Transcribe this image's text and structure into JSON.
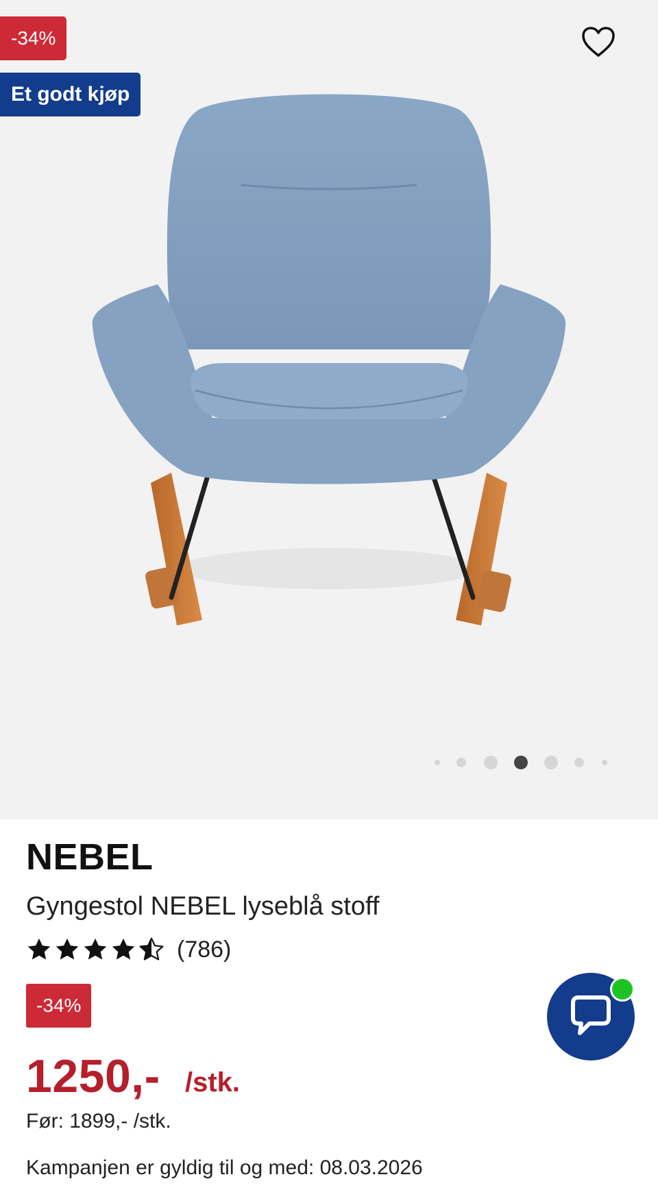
{
  "gallery": {
    "discount_badge": "-34%",
    "good_buy_badge": "Et godt kjøp",
    "favorite_icon": "heart-outline-icon",
    "image_count": 7,
    "active_image_index": 3
  },
  "product": {
    "brand": "NEBEL",
    "name": "Gyngestol NEBEL lyseblå stoff",
    "rating": 4.5,
    "rating_max": 5,
    "review_count": "(786)",
    "discount_badge": "-34%",
    "price": "1250,-",
    "unit": "/stk.",
    "before_price": "Før: 1899,- /stk.",
    "campaign": "Kampanjen er gyldig til og med: 08.03.2026"
  },
  "chat": {
    "icon": "chat-bubble-icon",
    "online_indicator": "online-status-dot"
  },
  "colors": {
    "sale_red": "#cc2a36",
    "price_red": "#b51f2b",
    "brand_blue": "#143c8c",
    "online_green": "#1fc224",
    "gallery_bg": "#f3f2f2"
  }
}
